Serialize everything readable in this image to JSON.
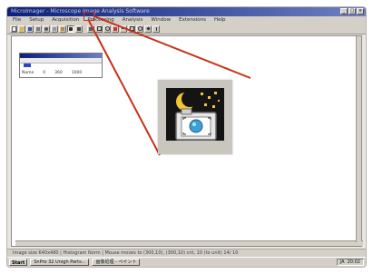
{
  "window": {
    "title": "MicroImager - Microscope Image Analysis Software",
    "controls": [
      "_",
      "□",
      "×"
    ]
  },
  "menu": [
    "File",
    "Setup",
    "Acquisition",
    "Processing",
    "Analysis",
    "Window",
    "Extensions",
    "Help"
  ],
  "toolbar": {
    "icons": [
      "new-icon",
      "open-icon",
      "save-icon",
      "print-icon",
      "cut-icon",
      "copy-icon",
      "paste-icon",
      "camera-capture-icon",
      "live-video-icon",
      "snapshot-icon",
      "select-icon",
      "zoom-icon",
      "measure-icon",
      "line-icon",
      "rect-icon",
      "ellipse-icon",
      "polygon-icon",
      "text-icon"
    ],
    "active": "camera-capture-icon"
  },
  "child_window": {
    "stats": [
      "Name",
      "0",
      "360",
      "1000"
    ]
  },
  "zoomed_icon": {
    "name": "camera-capture-icon",
    "accent": "#c7321a"
  },
  "status": {
    "text": "Image size 640x480 | Histogram Norm | Mouse moves to (300,10), (300,10) cnt, 10 (to unit) 14/ 10"
  },
  "taskbar": {
    "start": "Start",
    "items": [
      "SnPro 32 Unigh Parts...",
      "画像処理 - ペイント"
    ],
    "tray": [
      "JA",
      "20:02"
    ]
  },
  "colors": {
    "titlebar": "#0c1f7a",
    "callout": "#c7321a",
    "chrome": "#d4d0c8"
  }
}
